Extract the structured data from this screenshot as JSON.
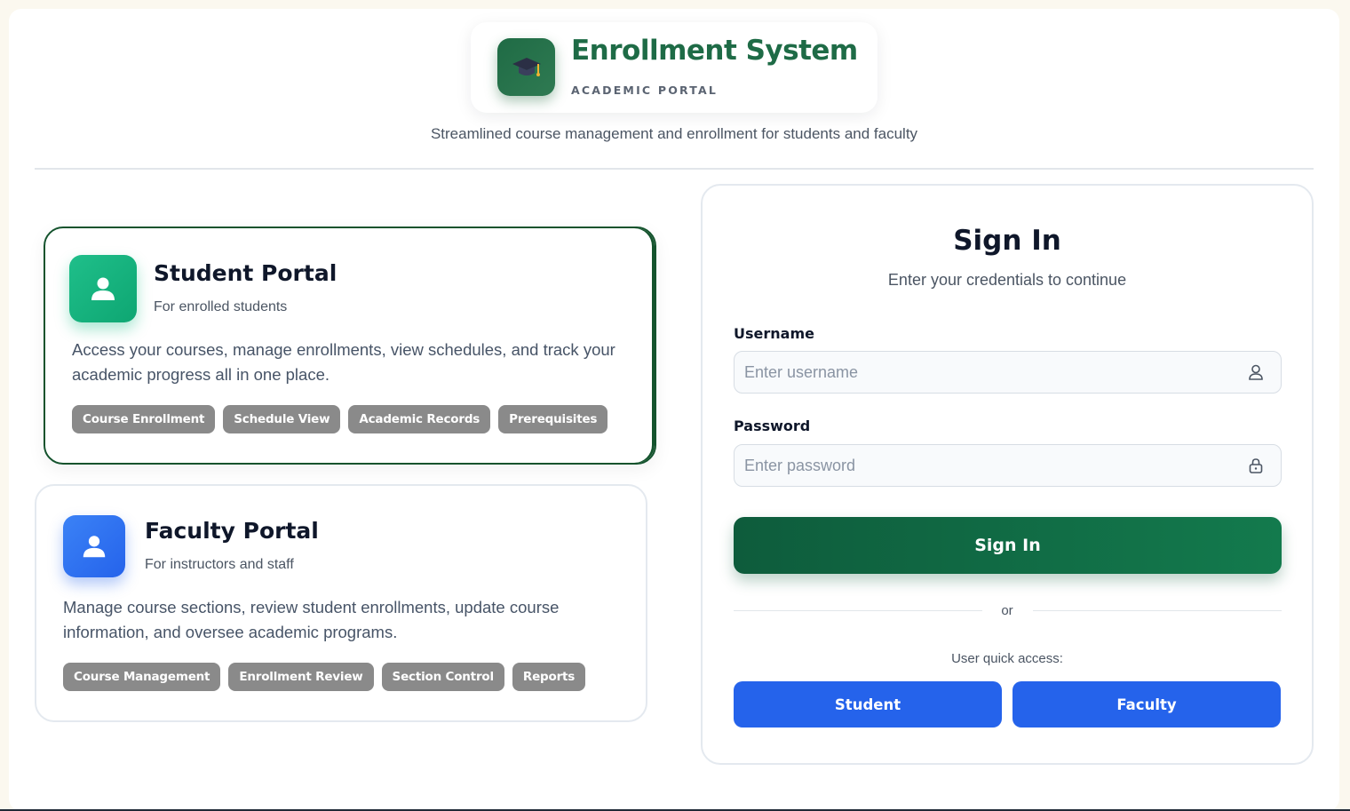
{
  "header": {
    "brand_title": "Enrollment System",
    "brand_subtitle": "ACADEMIC PORTAL",
    "brand_icon": "graduation-cap-icon",
    "tagline": "Streamlined course management and enrollment for students and faculty"
  },
  "portals": {
    "student": {
      "title": "Student Portal",
      "subtitle": "For enrolled students",
      "description": "Access your courses, manage enrollments, view schedules, and track your academic progress all in one place.",
      "tags": [
        "Course Enrollment",
        "Schedule View",
        "Academic Records",
        "Prerequisites"
      ],
      "accent": "#10b981",
      "selected": true
    },
    "faculty": {
      "title": "Faculty Portal",
      "subtitle": "For instructors and staff",
      "description": "Manage course sections, review student enrollments, update course information, and oversee academic programs.",
      "tags": [
        "Course Management",
        "Enrollment Review",
        "Section Control",
        "Reports"
      ],
      "accent": "#2563eb",
      "selected": false
    }
  },
  "signin": {
    "title": "Sign In",
    "subtitle": "Enter your credentials to continue",
    "username_label": "Username",
    "username_placeholder": "Enter username",
    "username_value": "",
    "password_label": "Password",
    "password_placeholder": "Enter password",
    "password_value": "",
    "submit_label": "Sign In",
    "or_text": "or",
    "quick_access_label": "User quick access:",
    "quick_student": "Student",
    "quick_faculty": "Faculty"
  },
  "colors": {
    "primary_green": "#137a4d",
    "quick_blue": "#2563eb",
    "tag_gray": "#8a8a8a"
  }
}
